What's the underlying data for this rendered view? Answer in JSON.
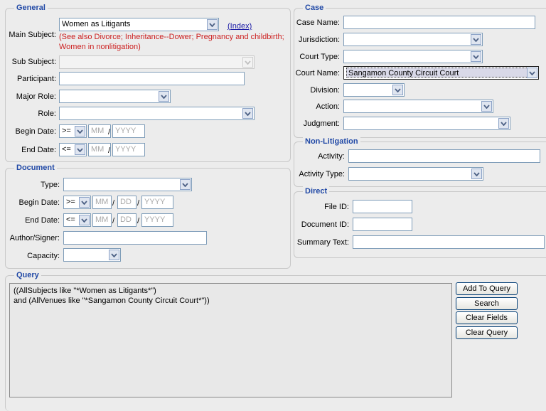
{
  "general": {
    "legend": "General",
    "main_subject_label": "Main Subject:",
    "main_subject_value": "Women as Litigants",
    "index_link": "(Index)",
    "see_also_line1": "(See also Divorce; Inheritance--Dower; Pregnancy and childbirth;",
    "see_also_line2": "Women in nonlitigation)",
    "sub_subject_label": "Sub Subject:",
    "participant_label": "Participant:",
    "major_role_label": "Major Role:",
    "role_label": "Role:",
    "begin_date_label": "Begin Date:",
    "begin_op": ">=",
    "end_date_label": "End Date:",
    "end_op": "<=",
    "mm_placeholder": "MM",
    "yyyy_placeholder": "YYYY",
    "slash": "/"
  },
  "document": {
    "legend": "Document",
    "type_label": "Type:",
    "begin_date_label": "Begin Date:",
    "begin_op": ">=",
    "end_date_label": "End Date:",
    "end_op": "<=",
    "mm_placeholder": "MM",
    "dd_placeholder": "DD",
    "yyyy_placeholder": "YYYY",
    "slash": "/",
    "author_label": "Author/Signer:",
    "capacity_label": "Capacity:"
  },
  "case": {
    "legend": "Case",
    "case_name_label": "Case Name:",
    "jurisdiction_label": "Jurisdiction:",
    "court_type_label": "Court Type:",
    "court_name_label": "Court Name:",
    "court_name_value": "Sangamon County Circuit Court",
    "division_label": "Division:",
    "action_label": "Action:",
    "judgment_label": "Judgment:"
  },
  "nonlit": {
    "legend": "Non-Litigation",
    "activity_label": "Activity:",
    "activity_type_label": "Activity Type:"
  },
  "direct": {
    "legend": "Direct",
    "file_id_label": "File ID:",
    "document_id_label": "Document ID:",
    "summary_label": "Summary Text:"
  },
  "query": {
    "legend": "Query",
    "line1": "((AllSubjects like \"*Women as Litigants*\")",
    "line2": "and (AllVenues like \"*Sangamon County Circuit Court*\"))",
    "add_button": "Add To Query",
    "search_button": "Search",
    "clear_fields_button": "Clear Fields",
    "clear_query_button": "Clear Query"
  },
  "icons": {
    "dropdown": "chevron-down-icon"
  }
}
